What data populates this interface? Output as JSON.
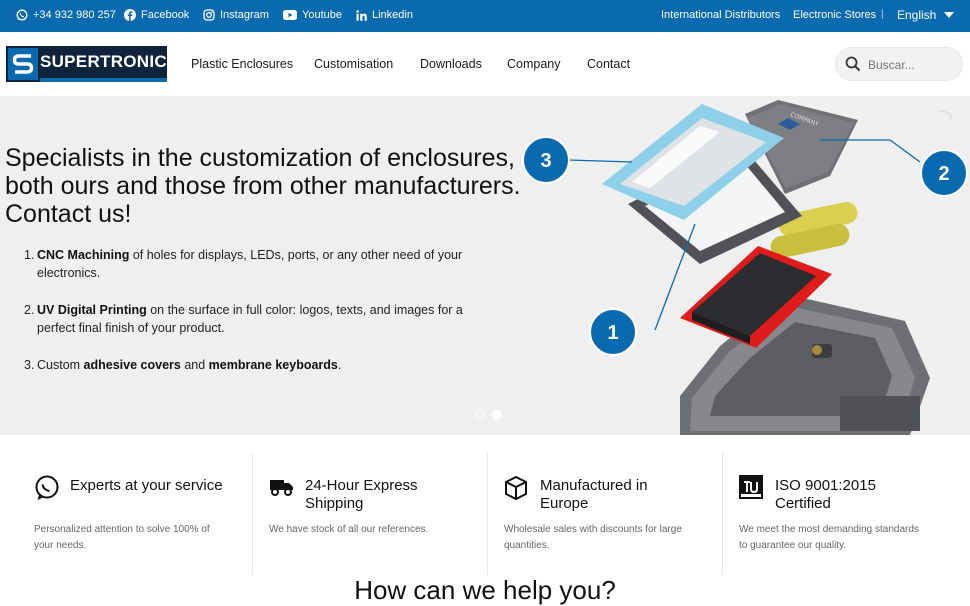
{
  "topbar": {
    "phone": "+34 932 980 257",
    "social": [
      "Facebook",
      "Instagram",
      "Youtube",
      "Linkedin"
    ],
    "links": [
      "International Distributors",
      "Electronic Stores"
    ],
    "language": "English"
  },
  "header": {
    "logo_text": "SUPERTRONIC",
    "nav": [
      "Plastic Enclosures",
      "Customisation",
      "Downloads",
      "Company",
      "Contact"
    ],
    "search_placeholder": "Buscar..."
  },
  "hero": {
    "title": "Specialists in the customization of enclosures, both ours and those from other manufacturers. Contact us!",
    "items": [
      {
        "num": "1.",
        "bold": "CNC Machining",
        "rest": " of holes for displays, LEDs, ports, or any other need of your electronics."
      },
      {
        "num": "2.",
        "bold": "UV Digital Printing",
        "rest": " on the surface in full color: logos, texts, and images for a perfect final finish of your product."
      },
      {
        "num": "3.",
        "pre": "Custom ",
        "bold": "adhesive covers",
        "mid": " and ",
        "bold2": "membrane keyboards",
        "end": "."
      }
    ],
    "callouts": [
      "1",
      "2",
      "3"
    ],
    "device_label": "COMPANY"
  },
  "features": [
    {
      "title": "Experts at your service",
      "text": "Personalized attention to solve 100% of your needs."
    },
    {
      "title": "24-Hour Express Shipping",
      "text": "We have stock of all our references."
    },
    {
      "title": "Manufactured in Europe",
      "text": "Wholesale sales with discounts for large quantities."
    },
    {
      "title": "ISO 9001:2015 Certified",
      "text": "We meet the most demanding standards to guarantee our quality."
    }
  ],
  "help_heading": "How can we help you?",
  "colors": {
    "primary": "#0a6ab0",
    "navy": "#10233d",
    "callout": "#0a6ab0"
  },
  "icons": [
    "whatsapp-icon",
    "facebook-icon",
    "instagram-icon",
    "youtube-icon",
    "linkedin-icon",
    "chevron-down-icon",
    "search-icon",
    "chat-icon",
    "truck-icon",
    "box-icon",
    "tuv-icon"
  ]
}
